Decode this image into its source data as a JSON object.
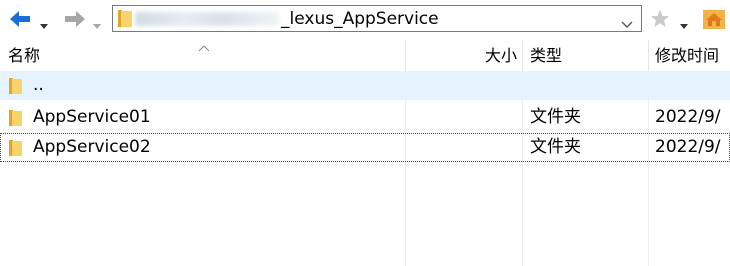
{
  "toolbar": {
    "back_icon": "back-arrow-icon",
    "forward_icon": "forward-arrow-icon",
    "address_path": "_lexus_AppService",
    "bookmark_icon": "star-icon",
    "home_icon": "home-folder-icon",
    "accent": "#0a63c9"
  },
  "columns": {
    "name": "名称",
    "size": "大小",
    "type": "类型",
    "modified": "修改时间"
  },
  "rows": [
    {
      "name": "..",
      "type": "",
      "modified": ""
    },
    {
      "name": "AppService01",
      "type": "文件夹",
      "modified": "2022/9/"
    },
    {
      "name": "AppService02",
      "type": "文件夹",
      "modified": "2022/9/"
    }
  ]
}
